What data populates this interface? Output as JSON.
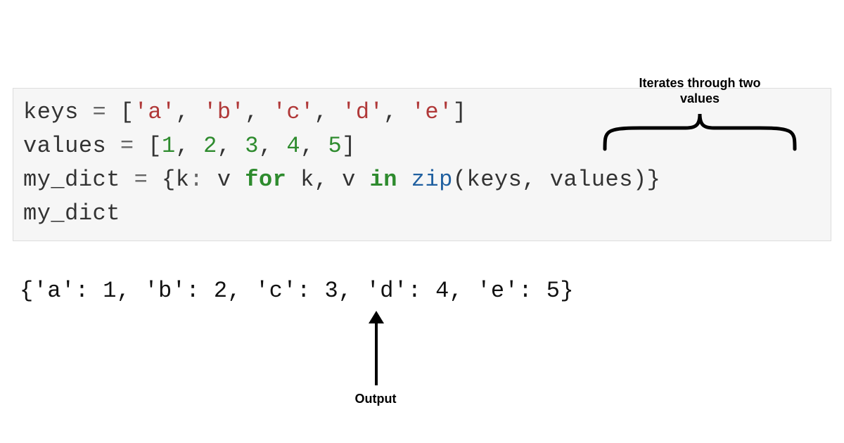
{
  "code": {
    "line1": {
      "var": "keys",
      "eq": " = ",
      "lb": "[",
      "s1": "'a'",
      "c1": ", ",
      "s2": "'b'",
      "c2": ", ",
      "s3": "'c'",
      "c3": ", ",
      "s4": "'d'",
      "c4": ", ",
      "s5": "'e'",
      "rb": "]"
    },
    "line2": {
      "var": "values",
      "eq": " = ",
      "lb": "[",
      "n1": "1",
      "c1": ", ",
      "n2": "2",
      "c2": ", ",
      "n3": "3",
      "c3": ", ",
      "n4": "4",
      "c4": ", ",
      "n5": "5",
      "rb": "]"
    },
    "line3": {
      "var": "my_dict",
      "eq": " = ",
      "lb": "{",
      "k": "k",
      "colon": ": ",
      "v": "v",
      "sp1": " ",
      "for": "for",
      "sp2": " ",
      "k2": "k",
      "cv": ", ",
      "v2": "v",
      "sp3": " ",
      "in": "in",
      "sp4": " ",
      "zip": "zip",
      "lp": "(",
      "a1": "keys",
      "ca": ", ",
      "a2": "values",
      "rp": ")",
      "rb": "}"
    },
    "line4": {
      "var": "my_dict"
    }
  },
  "output": "{'a': 1, 'b': 2, 'c': 3, 'd': 4, 'e': 5}",
  "annotations": {
    "top": "Iterates through two values",
    "bottom": "Output"
  }
}
